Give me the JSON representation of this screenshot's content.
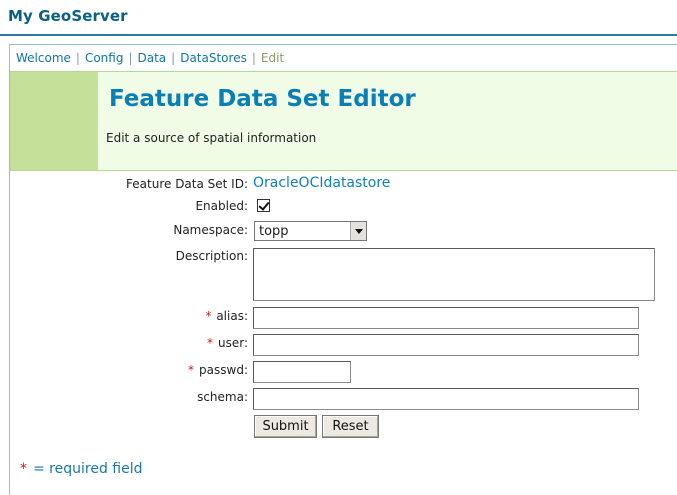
{
  "app": {
    "title": "My GeoServer"
  },
  "breadcrumb": [
    {
      "label": "Welcome"
    },
    {
      "label": "Config"
    },
    {
      "label": "Data"
    },
    {
      "label": "DataStores"
    },
    {
      "label": "Edit"
    }
  ],
  "banner": {
    "title": "Feature Data Set Editor",
    "subtitle": "Edit a source of spatial information"
  },
  "form": {
    "id_label": "Feature Data Set ID:",
    "id_value": "OracleOCIdatastore",
    "enabled_label": "Enabled:",
    "enabled_checked": true,
    "namespace_label": "Namespace:",
    "namespace_value": "topp",
    "description_label": "Description:",
    "description_value": "",
    "alias_label": "alias:",
    "alias_value": "",
    "user_label": "user:",
    "user_value": "",
    "passwd_label": "passwd:",
    "passwd_value": "",
    "schema_label": "schema:",
    "schema_value": "",
    "required_marker": "*",
    "submit_label": "Submit",
    "reset_label": "Reset"
  },
  "footer": {
    "required_star": "*",
    "required_text": "= required field"
  },
  "colors": {
    "brand": "#0a5f86",
    "link": "#1274a3",
    "title": "#0a7fb5",
    "banner_bg": "#f1fce6",
    "banner_stripe": "#c4e099",
    "required": "#d01818"
  }
}
